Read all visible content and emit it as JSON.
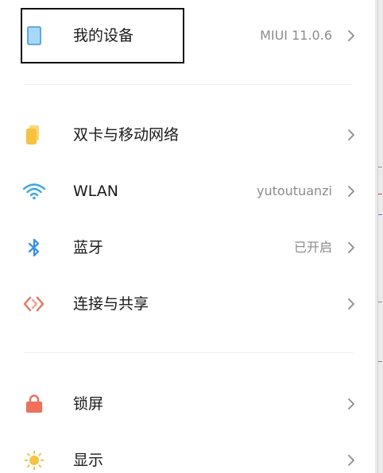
{
  "settings": {
    "device": {
      "label": "我的设备",
      "value": "MIUI 11.0.6",
      "icon": "phone-device-icon"
    },
    "items": [
      {
        "key": "sim",
        "label": "双卡与移动网络",
        "value": "",
        "icon": "sim-card-icon",
        "color": "#F9C23C"
      },
      {
        "key": "wlan",
        "label": "WLAN",
        "value": "yutoutuanzi",
        "icon": "wifi-icon",
        "color": "#2FA9F2"
      },
      {
        "key": "bluetooth",
        "label": "蓝牙",
        "value": "已开启",
        "icon": "bluetooth-icon",
        "color": "#2F8FF2"
      },
      {
        "key": "share",
        "label": "连接与共享",
        "value": "",
        "icon": "connection-share-icon",
        "color": "#F2705A"
      },
      {
        "key": "lock",
        "label": "锁屏",
        "value": "",
        "icon": "lock-icon",
        "color": "#F2705A"
      },
      {
        "key": "display",
        "label": "显示",
        "value": "",
        "icon": "sun-icon",
        "color": "#F9C23C"
      }
    ]
  },
  "colors": {
    "device_icon_fill": "#A8D8F5",
    "device_icon_stroke": "#3A9BE0",
    "chevron": "#8c8c8c",
    "label_text": "#1a1a1a",
    "value_text": "#8c8c8c"
  }
}
